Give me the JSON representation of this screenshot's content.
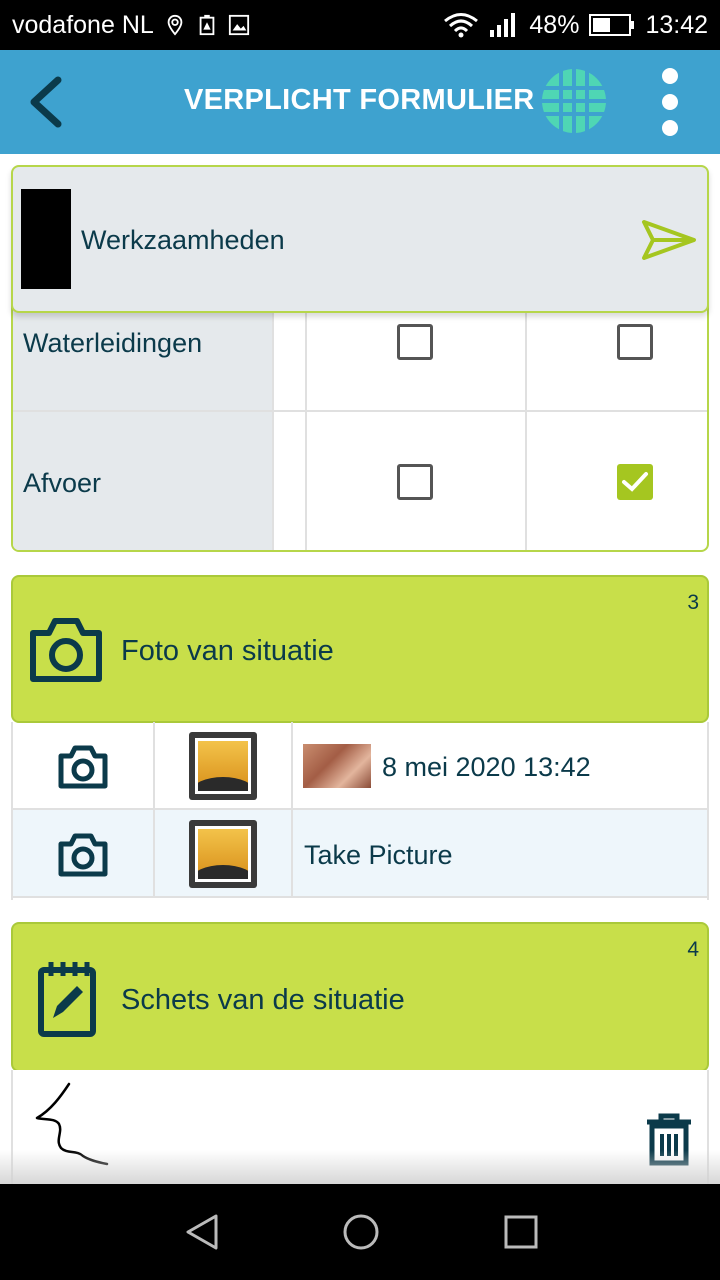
{
  "status_bar": {
    "carrier": "vodafone NL",
    "battery": "48%",
    "time": "13:42"
  },
  "app_bar": {
    "title": "VERPLICHT FORMULIER"
  },
  "header_card": {
    "title": "Werkzaamheden"
  },
  "table": {
    "rows": [
      {
        "label": "Waterleidingen",
        "col1_checked": false,
        "col2_checked": false
      },
      {
        "label": "Afvoer",
        "col1_checked": false,
        "col2_checked": true
      }
    ]
  },
  "photo_section": {
    "title": "Foto van situatie",
    "count": "3",
    "items": [
      {
        "text": "8 mei 2020 13:42",
        "has_thumbnail": true
      },
      {
        "text": "Take Picture",
        "has_thumbnail": false
      }
    ]
  },
  "sketch_section": {
    "title": "Schets van de situatie",
    "count": "4"
  },
  "colors": {
    "app_bar": "#3ea2cf",
    "section_green": "#c8df4a",
    "accent_green": "#a5c620",
    "text_dark": "#0b3a4a"
  },
  "icons": [
    "back-arrow-icon",
    "globe-icon",
    "more-vert-icon",
    "send-icon",
    "camera-icon",
    "gallery-icon",
    "notepad-pencil-icon",
    "trash-icon",
    "nav-back-icon",
    "nav-home-icon",
    "nav-recents-icon"
  ]
}
